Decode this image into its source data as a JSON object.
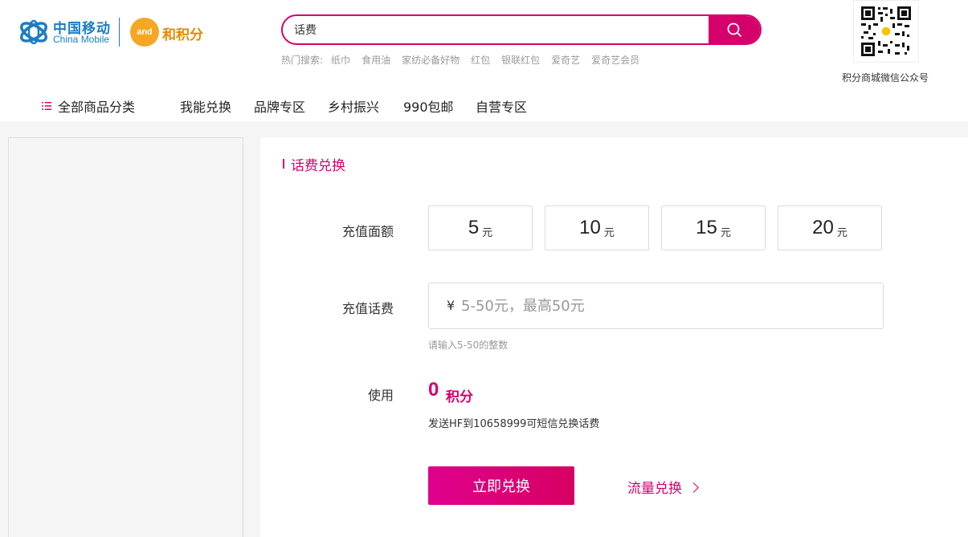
{
  "colors": {
    "accent": "#d6006c",
    "brand_blue": "#1b7dc4",
    "brand_orange": "#f5a623"
  },
  "header": {
    "logo_cn": "中国移动",
    "logo_en": "China Mobile",
    "badge_text": "and",
    "points_brand": "和积分",
    "search": {
      "value": "话费",
      "icon": "search-icon"
    },
    "hot_search": {
      "label": "热门搜索:",
      "items": [
        "纸巾",
        "食用油",
        "家纺必备好物",
        "红包",
        "银联红包",
        "爱奇艺",
        "爱奇艺会员"
      ]
    },
    "qr_label": "积分商城微信公众号"
  },
  "nav": {
    "category_label": "全部商品分类",
    "items": [
      "我能兑换",
      "品牌专区",
      "乡村振兴",
      "990包邮",
      "自营专区"
    ]
  },
  "main": {
    "section_title": "话费兑换",
    "amount_label": "充值面额",
    "amounts": [
      {
        "value": "5",
        "unit": "元"
      },
      {
        "value": "10",
        "unit": "元"
      },
      {
        "value": "15",
        "unit": "元"
      },
      {
        "value": "20",
        "unit": "元"
      }
    ],
    "custom_label": "充值话费",
    "currency_symbol": "¥",
    "custom_placeholder": "5-50元，最高50元",
    "custom_hint": "请输入5-50的整数",
    "use_label": "使用",
    "points_value": "0",
    "points_unit": "积分",
    "sms_hint": "发送HF到10658999可短信兑换话费",
    "redeem_label": "立即兑换",
    "data_link_label": "流量兑换"
  }
}
